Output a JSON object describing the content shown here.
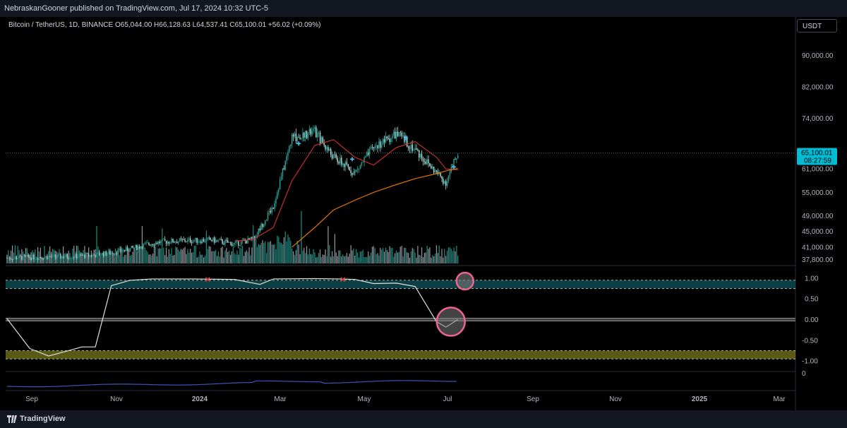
{
  "publisher_line": "NebraskanGooner published on TradingView.com, Jul 17, 2024 10:32 UTC-5",
  "symbol": {
    "name": "Bitcoin / TetherUS, 1D, BINANCE",
    "o_label": "O",
    "o": "65,044.00",
    "h_label": "H",
    "h": "66,128.63",
    "l_label": "L",
    "l": "64,537.41",
    "c_label": "C",
    "c": "65,100.01",
    "change": "+56.02 (+0.09%)"
  },
  "currency_button": "USDT",
  "last_price": {
    "price": "65,100.01",
    "countdown": "08:27:59"
  },
  "brand": "TradingView",
  "colors": {
    "up": "#26a69a",
    "candle_light": "#b2dfdb",
    "volume": "#b0b3bb",
    "ma_fast": "#d32f2f",
    "ma_slow": "#f57c00",
    "oscillator": "#e0e0e0",
    "upper_zone": "#0e4a4f",
    "lower_zone": "#6b6a18",
    "mid_zone": "#3a3a3a",
    "lower_line": "#3f51b5",
    "highlight": "#f06292",
    "marker": "#e53935",
    "price_tag": "#00bcd4"
  },
  "chart_data": {
    "type": "candlestick",
    "x_labels": [
      "Sep",
      "Nov",
      "2024",
      "Mar",
      "May",
      "Jul",
      "Sep",
      "Nov",
      "2025",
      "Mar"
    ],
    "x_label_bold": [
      "2024",
      "2025"
    ],
    "price_axis": {
      "ticks": [
        "90,000.00",
        "82,000.00",
        "74,000.00",
        "65,100.01",
        "61,000.00",
        "55,000.00",
        "49,000.00",
        "45,000.00",
        "41,000.00",
        "37,800.00"
      ],
      "ylim": [
        37000,
        97000
      ]
    },
    "price_series": {
      "x": [
        "2023-08-15",
        "2023-09-01",
        "2023-09-15",
        "2023-10-01",
        "2023-10-15",
        "2023-11-01",
        "2023-11-15",
        "2023-12-01",
        "2023-12-15",
        "2024-01-01",
        "2024-01-15",
        "2024-02-01",
        "2024-02-15",
        "2024-03-01",
        "2024-03-15",
        "2024-04-01",
        "2024-04-15",
        "2024-05-01",
        "2024-05-15",
        "2024-06-01",
        "2024-06-15",
        "2024-07-01",
        "2024-07-08",
        "2024-07-17"
      ],
      "close": [
        38200,
        38400,
        38500,
        38600,
        38800,
        39500,
        40500,
        42000,
        42500,
        42700,
        42800,
        41800,
        43000,
        51500,
        69000,
        70500,
        64000,
        60000,
        66500,
        70000,
        66000,
        60000,
        57500,
        65100
      ],
      "ma_fast": [
        null,
        null,
        null,
        null,
        null,
        null,
        null,
        null,
        null,
        null,
        null,
        42500,
        43000,
        46000,
        58000,
        67000,
        68500,
        64000,
        62000,
        66500,
        68000,
        64000,
        61000,
        60800
      ],
      "ma_slow": [
        null,
        null,
        null,
        null,
        null,
        null,
        null,
        null,
        null,
        null,
        null,
        null,
        null,
        null,
        41000,
        46000,
        50500,
        53000,
        55000,
        57000,
        58500,
        59800,
        60500,
        61100
      ]
    },
    "oscillator": {
      "axis_ticks": [
        "1.00",
        "0.50",
        "0.00",
        "-0.50",
        "-1.00"
      ],
      "ylim": [
        -1.1,
        1.1
      ],
      "zones": {
        "upper": [
          0.75,
          0.95
        ],
        "middle": [
          -0.03,
          0.03
        ],
        "lower": [
          -0.95,
          -0.75
        ]
      },
      "x": [
        "2023-08-15",
        "2023-09-01",
        "2023-09-15",
        "2023-10-01",
        "2023-10-10",
        "2023-10-20",
        "2023-11-01",
        "2023-11-15",
        "2023-12-01",
        "2024-01-01",
        "2024-02-01",
        "2024-02-20",
        "2024-03-01",
        "2024-04-01",
        "2024-04-20",
        "2024-05-01",
        "2024-05-15",
        "2024-06-01",
        "2024-06-15",
        "2024-07-01",
        "2024-07-08",
        "2024-07-17"
      ],
      "values": [
        0.02,
        -0.7,
        -0.88,
        -0.74,
        -0.66,
        -0.66,
        0.82,
        0.95,
        0.98,
        0.98,
        0.97,
        0.85,
        0.98,
        0.99,
        0.98,
        0.97,
        0.87,
        0.88,
        0.8,
        -0.05,
        -0.18,
        0.0
      ],
      "markers": [
        "2024-01-12",
        "2024-04-22"
      ]
    },
    "lower_pane_tick": "0"
  }
}
